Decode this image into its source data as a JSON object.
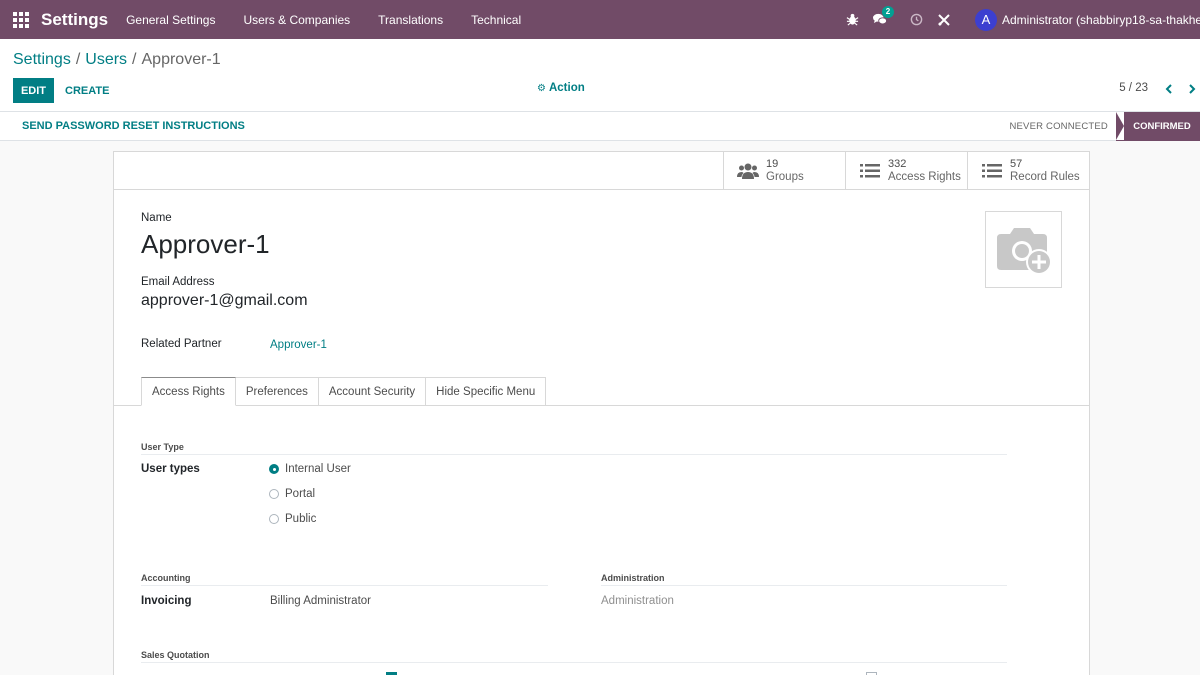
{
  "navbar": {
    "brand": "Settings",
    "menu": [
      "General Settings",
      "Users & Companies",
      "Translations",
      "Technical"
    ],
    "messages_badge": "2",
    "avatar_letter": "A",
    "user_name": "Administrator (shabbiryp18-sa-thakher1..."
  },
  "breadcrumb": {
    "root": "Settings",
    "sep": "/",
    "parent": "Users",
    "current": "Approver-1"
  },
  "toolbar": {
    "edit_label": "EDIT",
    "create_label": "CREATE",
    "action_label": "Action",
    "pager": "5 / 23"
  },
  "statusbar": {
    "reset_label": "SEND PASSWORD RESET INSTRUCTIONS",
    "never_connected": "NEVER CONNECTED",
    "confirmed": "CONFIRMED"
  },
  "stats": [
    {
      "value": "19",
      "label": "Groups",
      "icon": "users-icon"
    },
    {
      "value": "332",
      "label": "Access Rights",
      "icon": "list-icon"
    },
    {
      "value": "57",
      "label": "Record Rules",
      "icon": "list-icon"
    }
  ],
  "form": {
    "name_label": "Name",
    "name_value": "Approver-1",
    "email_label": "Email Address",
    "email_value": "approver-1@gmail.com",
    "partner_label": "Related Partner",
    "partner_value": "Approver-1"
  },
  "tabs": [
    "Access Rights",
    "Preferences",
    "Account Security",
    "Hide Specific Menu"
  ],
  "access": {
    "user_type_title": "User Type",
    "user_types_label": "User types",
    "options": [
      "Internal User",
      "Portal",
      "Public"
    ],
    "selected_option": "Internal User",
    "accounting_title": "Accounting",
    "invoicing_label": "Invoicing",
    "invoicing_value": "Billing Administrator",
    "administration_title": "Administration",
    "administration_value": "Administration",
    "sales_quotation_title": "Sales Quotation"
  },
  "colors": {
    "brand": "#714b67",
    "accent": "#017e84",
    "badge": "#01a093",
    "avatar": "#3c3fd0"
  }
}
